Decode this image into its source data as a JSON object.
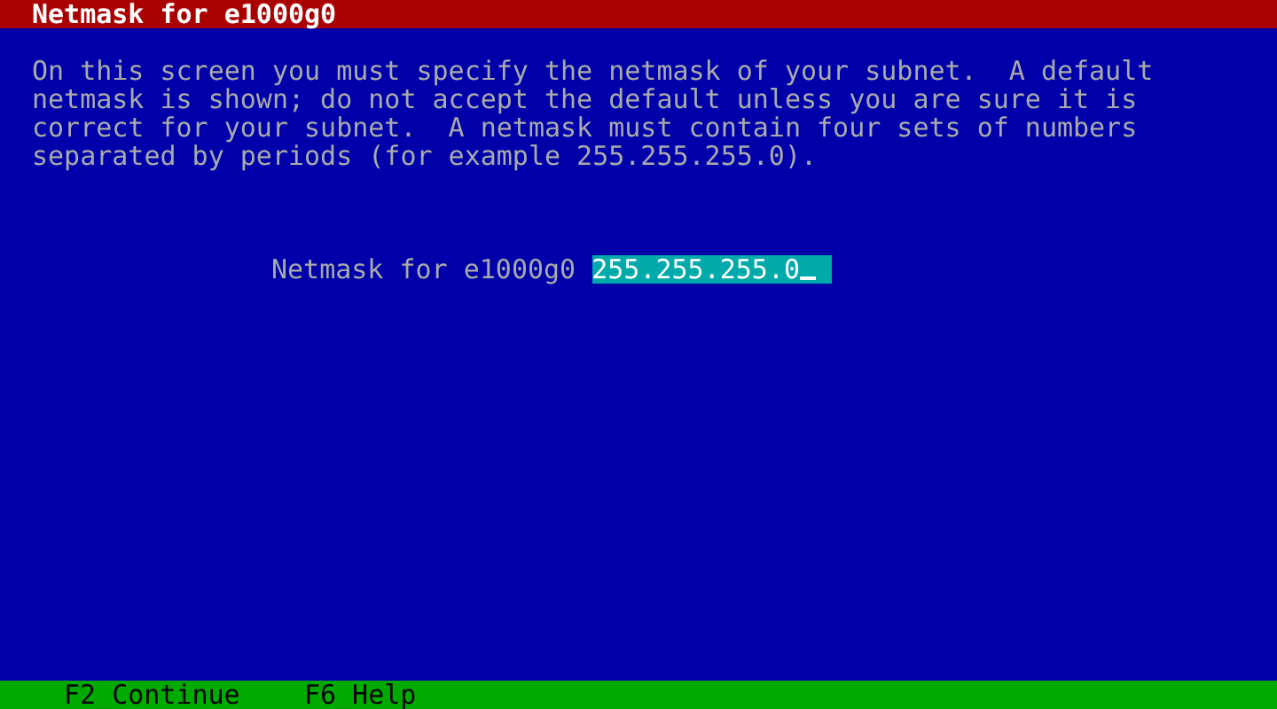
{
  "title": "Netmask for e1000g0",
  "description": "On this screen you must specify the netmask of your subnet.  A default netmask is shown; do not accept the default unless you are sure it is correct for your subnet.  A netmask must contain four sets of numbers separated by periods (for example 255.255.255.0).",
  "field": {
    "label": "Netmask for e1000g0",
    "value": "255.255.255.0"
  },
  "function_keys": [
    "F2_Continue",
    "F6_Help"
  ]
}
